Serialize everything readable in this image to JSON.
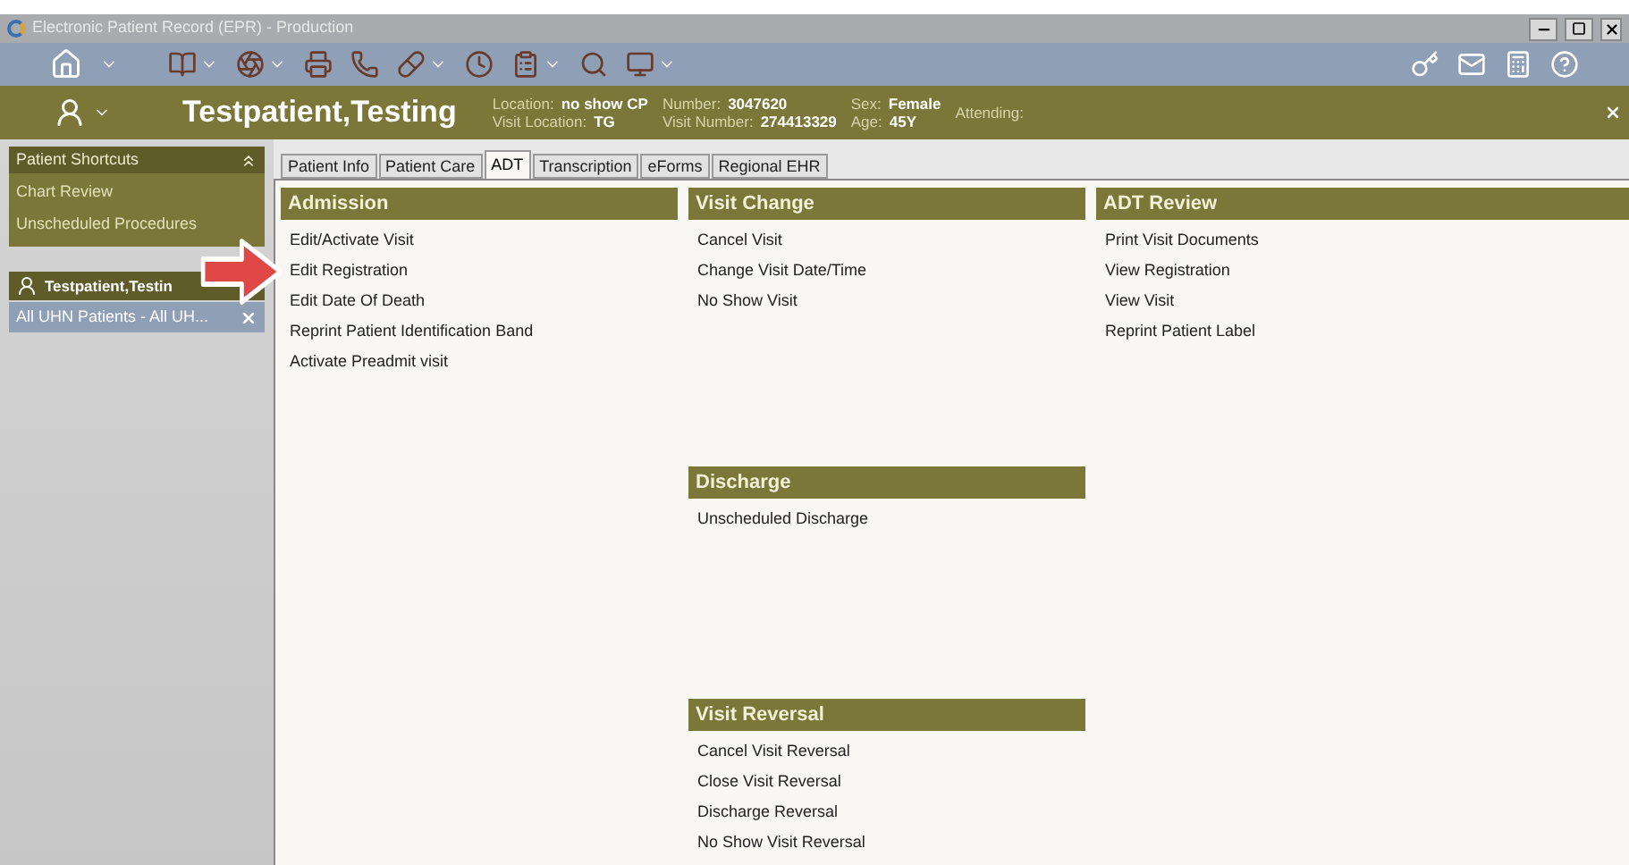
{
  "window": {
    "title": "Electronic Patient Record (EPR) - Production"
  },
  "patient_bar": {
    "name": "Testpatient,Testing",
    "columns": [
      {
        "items": [
          {
            "label": "Location:",
            "value": "no show CP"
          },
          {
            "label": "Visit Location:",
            "value": "TG"
          }
        ]
      },
      {
        "items": [
          {
            "label": "Number:",
            "value": "3047620"
          },
          {
            "label": "Visit Number:",
            "value": "274413329"
          }
        ]
      },
      {
        "items": [
          {
            "label": "Sex:",
            "value": "Female"
          },
          {
            "label": "Age:",
            "value": "45Y"
          }
        ]
      },
      {
        "items": [
          {
            "label": "Attending:"
          }
        ]
      }
    ]
  },
  "sidebar": {
    "shortcuts": {
      "title": "Patient Shortcuts",
      "expanded": true,
      "items": [
        "Chart Review",
        "Unscheduled Procedures"
      ]
    },
    "patient": {
      "name": "Testpatient,Testin"
    },
    "list": {
      "label": "All UHN Patients - All UH..."
    }
  },
  "tabs": [
    {
      "label": "Patient Info",
      "selected": false
    },
    {
      "label": "Patient Care",
      "selected": false
    },
    {
      "label": "ADT",
      "selected": true
    },
    {
      "label": "Transcription",
      "selected": false
    },
    {
      "label": "eForms",
      "selected": false
    },
    {
      "label": "Regional EHR",
      "selected": false
    }
  ],
  "columns": [
    {
      "sections": [
        {
          "title": "Admission",
          "items": [
            "Edit/Activate Visit",
            "Edit Registration",
            "Edit Date Of Death",
            "Reprint Patient Identification Band",
            "Activate Preadmit visit"
          ]
        }
      ]
    },
    {
      "sections": [
        {
          "title": "Visit Change",
          "items": [
            "Cancel Visit",
            "Change Visit Date/Time",
            "No Show Visit"
          ]
        },
        {
          "title": "Discharge",
          "items": [
            "Unscheduled Discharge"
          ]
        },
        {
          "title": "Visit Reversal",
          "items": [
            "Cancel Visit Reversal",
            "Close Visit Reversal",
            "Discharge Reversal",
            "No Show Visit Reversal"
          ]
        }
      ]
    },
    {
      "sections": [
        {
          "title": "ADT Review",
          "items": [
            "Print Visit Documents",
            "View Registration",
            "View Visit",
            "Reprint Patient Label"
          ]
        }
      ]
    }
  ]
}
